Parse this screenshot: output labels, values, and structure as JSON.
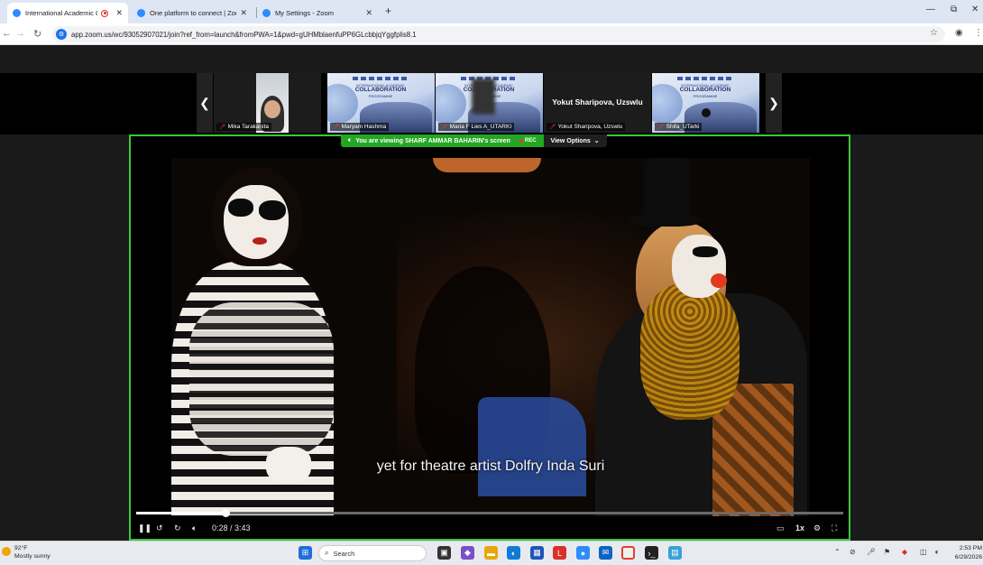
{
  "browser": {
    "tabs": [
      {
        "title": "International Academic Co",
        "recording": true
      },
      {
        "title": "One platform to connect | Zoo"
      },
      {
        "title": "My Settings - Zoom"
      }
    ],
    "new_tab": "+",
    "url": "app.zoom.us/wc/93052907021/join?ref_from=launch&fromPWA=1&pwd=gUHMblaenfuPP6GLcbbjqYggfplis8.1",
    "window_controls": {
      "minimize": "—",
      "restore": "⧉",
      "close": "✕"
    }
  },
  "zoom": {
    "thumbnails": [
      {
        "name": "Mika Tarakanita"
      },
      {
        "name": "Maryam Hashma",
        "slide_small": "INTERNATIONAL ACADEMIC",
        "slide_title": "COLLABORATION",
        "slide_sub": "PROGRAMME"
      },
      {
        "name": "Maria F Lies A_UTARKI",
        "slide_small": "INTERNATIONAL ACADEMIC",
        "slide_title": "COLLABORATION",
        "slide_sub": "PROGRAMME"
      },
      {
        "name": "Yokut Sharipova, Uzswlu",
        "big_name": "Yokut Sharipova, Uzswlu"
      },
      {
        "name": "Shifa_UTarki",
        "slide_small": "INTERNATIONAL ACADEMIC",
        "slide_title": "COLLABORATION",
        "slide_sub": "PROGRAMME"
      }
    ],
    "share_banner": {
      "prefix": "You are viewing",
      "presenter": "SHARF AMMAR BAHARIN's screen",
      "rec": "REC",
      "view_options": "View Options"
    },
    "accent_color": "#3ac83a"
  },
  "video": {
    "subtitle": "yet for theatre artist Dolfry Inda Suri",
    "time": "0:28 / 3:43",
    "progress": 0.126,
    "speed": "1x"
  },
  "taskbar": {
    "weather_temp": "92°F",
    "weather_desc": "Mostly sunny",
    "search_placeholder": "Search",
    "time": "2:53 PM",
    "date": "6/29/2026"
  }
}
